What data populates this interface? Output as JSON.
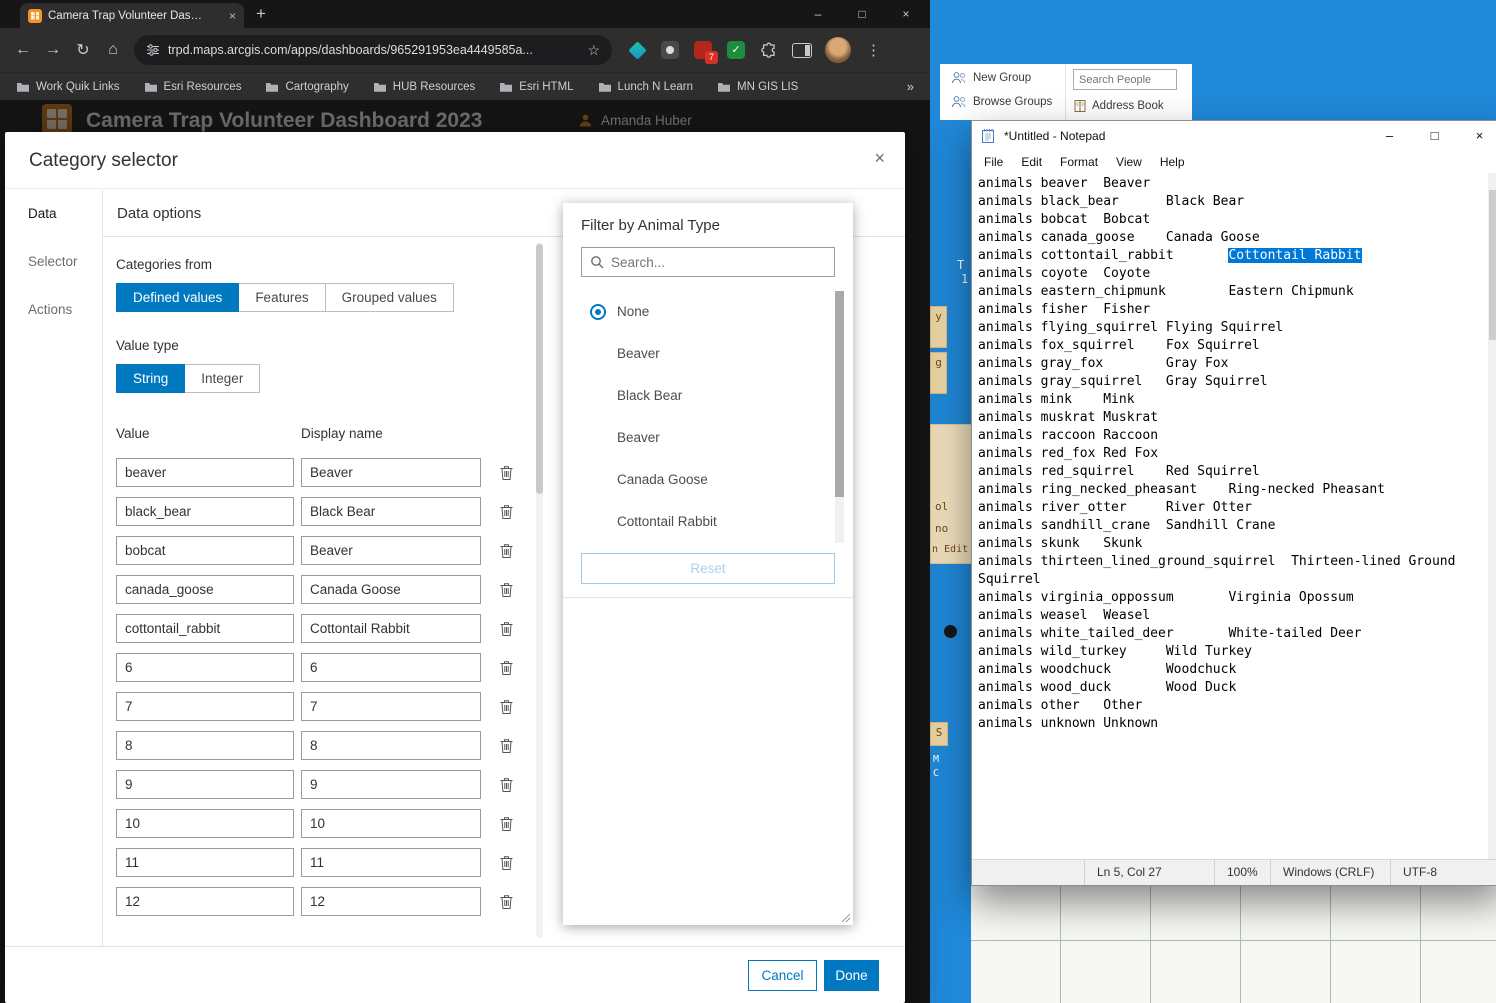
{
  "colors": {
    "accent_blue": "#0079c1",
    "selection_blue": "#0078d7",
    "chrome_dark": "#2e2e2e",
    "desktop_blue": "#2089d9",
    "favicon_orange": "#f7941e"
  },
  "icons": {
    "minimize": "–",
    "maximize": "□",
    "close": "×",
    "back": "←",
    "forward": "→",
    "reload": "↻",
    "home": "⌂",
    "star": "☆",
    "menu_dots": "⋮",
    "new_tab": "+",
    "bookmarks_overflow": "»",
    "check": "✓",
    "extension_badge_count": "7"
  },
  "browser": {
    "tab_title": "Camera Trap Volunteer Dashboard 2023",
    "url": "trpd.maps.arcgis.com/apps/dashboards/965291953ea4449585a...",
    "bookmarks": [
      "Work Quik Links",
      "Esri Resources",
      "Cartography",
      "HUB Resources",
      "Esri HTML",
      "Lunch N Learn",
      "MN GIS LIS"
    ]
  },
  "dashboard": {
    "title": "Camera Trap Volunteer Dashboard 2023",
    "user_name": "Amanda Huber"
  },
  "modal": {
    "title": "Category selector",
    "nav": [
      "Data",
      "Selector",
      "Actions"
    ],
    "content_title": "Data options",
    "categories_from_label": "Categories from",
    "category_source_tabs": [
      "Defined values",
      "Features",
      "Grouped values"
    ],
    "selected_source_tab": "Defined values",
    "value_type_label": "Value type",
    "value_type_tabs": [
      "String",
      "Integer"
    ],
    "selected_value_type": "String",
    "columns": {
      "value": "Value",
      "display_name": "Display name"
    },
    "rows": [
      {
        "value": "beaver",
        "display": "Beaver"
      },
      {
        "value": "black_bear",
        "display": "Black Bear"
      },
      {
        "value": "bobcat",
        "display": "Beaver"
      },
      {
        "value": "canada_goose",
        "display": "Canada Goose"
      },
      {
        "value": "cottontail_rabbit",
        "display": "Cottontail Rabbit"
      },
      {
        "value": "6",
        "display": "6"
      },
      {
        "value": "7",
        "display": "7"
      },
      {
        "value": "8",
        "display": "8"
      },
      {
        "value": "9",
        "display": "9"
      },
      {
        "value": "10",
        "display": "10"
      },
      {
        "value": "11",
        "display": "11"
      },
      {
        "value": "12",
        "display": "12"
      }
    ],
    "cancel_label": "Cancel",
    "done_label": "Done"
  },
  "filter_panel": {
    "title": "Filter by Animal Type",
    "search_placeholder": "Search...",
    "options": [
      "None",
      "Beaver",
      "Black Bear",
      "Beaver",
      "Canada Goose",
      "Cottontail Rabbit"
    ],
    "selected_option": "None",
    "reset_label": "Reset"
  },
  "outlook": {
    "new_group": "New Group",
    "browse_groups": "Browse Groups",
    "search_people_placeholder": "Search People",
    "address_book": "Address Book"
  },
  "notepad": {
    "title": "*Untitled - Notepad",
    "menus": [
      "File",
      "Edit",
      "Format",
      "View",
      "Help"
    ],
    "text_before_selection": "animals beaver\tBeaver\nanimals black_bear\tBlack Bear\nanimals bobcat\tBobcat\nanimals canada_goose\tCanada Goose\nanimals cottontail_rabbit\t",
    "selection": "Cottontail Rabbit",
    "text_after_selection": "\nanimals coyote\tCoyote\nanimals eastern_chipmunk\tEastern Chipmunk\nanimals fisher\tFisher\nanimals flying_squirrel\tFlying Squirrel\nanimals fox_squirrel\tFox Squirrel\nanimals gray_fox\tGray Fox\nanimals gray_squirrel\tGray Squirrel\nanimals mink\tMink\nanimals muskrat\tMuskrat\nanimals raccoon\tRaccoon\nanimals red_fox\tRed Fox\nanimals red_squirrel\tRed Squirrel\nanimals ring_necked_pheasant\tRing-necked Pheasant\nanimals river_otter\tRiver Otter\nanimals sandhill_crane\tSandhill Crane\nanimals skunk\tSkunk\nanimals thirteen_lined_ground_squirrel\tThirteen-lined Ground Squirrel\nanimals virginia_oppossum\tVirginia Opossum\nanimals weasel\tWeasel\nanimals white_tailed_deer\tWhite-tailed Deer\nanimals wild_turkey\tWild Turkey\nanimals woodchuck\tWoodchuck\nanimals wood_duck\tWood Duck\nanimals other\tOther\nanimals unknown\tUnknown",
    "status": {
      "ln_col": "Ln 5, Col 27",
      "zoom": "100%",
      "eol": "Windows (CRLF)",
      "encoding": "UTF-8"
    }
  },
  "fragments": [
    "y",
    "g",
    "ol",
    "no",
    "n Edit",
    "T",
    "1",
    "S",
    "M",
    "C"
  ]
}
